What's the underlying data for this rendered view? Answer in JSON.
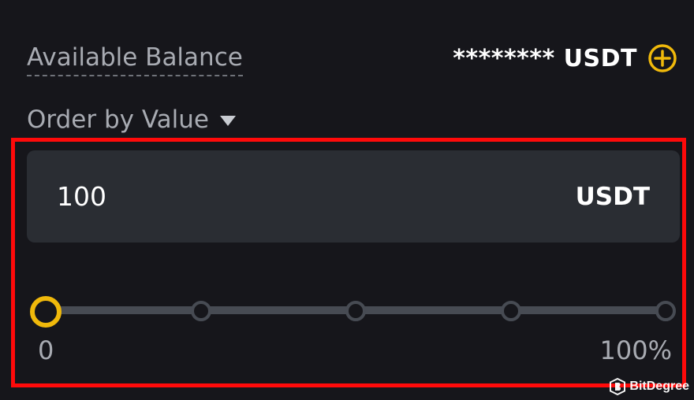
{
  "balance": {
    "label": "Available Balance",
    "amount": "******** USDT",
    "add_icon": "plus-circle-icon"
  },
  "order_type": {
    "label": "Order by Value",
    "icon": "caret-down-icon"
  },
  "order_input": {
    "value": "100",
    "unit": "USDT"
  },
  "slider": {
    "percent": 0,
    "steps": [
      0,
      25,
      50,
      75,
      100
    ],
    "min_label": "0",
    "max_label": "100%"
  },
  "watermark": {
    "text": "BitDegree"
  },
  "colors": {
    "accent": "#f0b90b",
    "highlight": "#ff0a0a",
    "background": "#16161b",
    "input_bg": "#2a2d33"
  }
}
